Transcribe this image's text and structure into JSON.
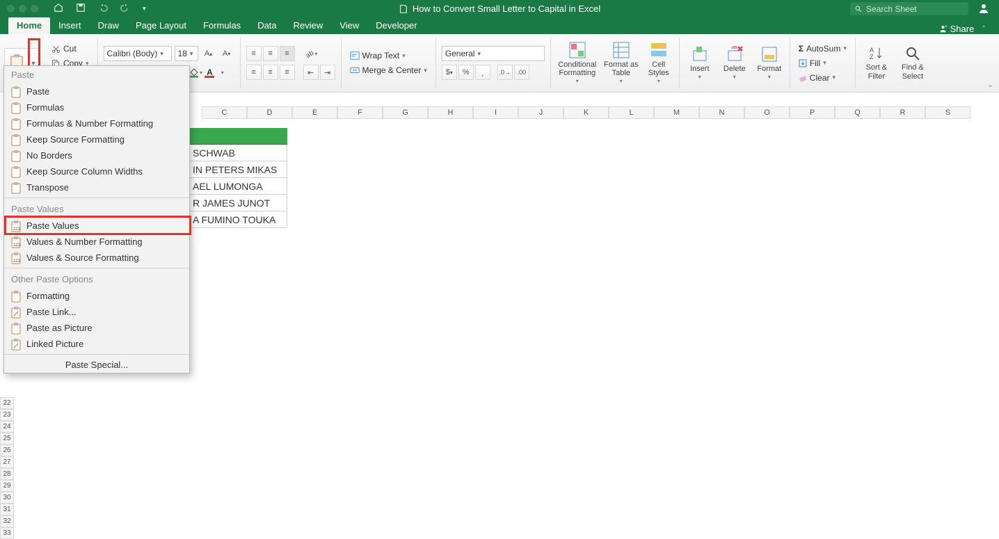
{
  "titlebar": {
    "title": "How to Convert Small Letter to Capital in Excel",
    "search_placeholder": "Search Sheet"
  },
  "tabs": {
    "items": [
      "Home",
      "Insert",
      "Draw",
      "Page Layout",
      "Formulas",
      "Data",
      "Review",
      "View",
      "Developer"
    ],
    "active": "Home",
    "share": "Share"
  },
  "clipboard": {
    "cut": "Cut",
    "copy": "Copy"
  },
  "font": {
    "name": "Calibri (Body)",
    "size": "18"
  },
  "alignment": {
    "wrap": "Wrap Text",
    "merge": "Merge & Center"
  },
  "number": {
    "format": "General"
  },
  "cells_group": {
    "cond": "Conditional Formatting",
    "fmtTable": "Format as Table",
    "cellStyles": "Cell Styles",
    "insert": "Insert",
    "delete": "Delete",
    "format": "Format"
  },
  "editing": {
    "autosum": "AutoSum",
    "fill": "Fill",
    "clear": "Clear",
    "sort": "Sort & Filter",
    "find": "Find & Select"
  },
  "menu": {
    "section_paste": "Paste",
    "items_paste": [
      "Paste",
      "Formulas",
      "Formulas & Number Formatting",
      "Keep Source Formatting",
      "No Borders",
      "Keep Source Column Widths",
      "Transpose"
    ],
    "section_values": "Paste Values",
    "items_values": [
      "Paste Values",
      "Values & Number Formatting",
      "Values & Source Formatting"
    ],
    "section_other": "Other Paste Options",
    "items_other": [
      "Formatting",
      "Paste Link...",
      "Paste as Picture",
      "Linked Picture"
    ],
    "special": "Paste Special..."
  },
  "sheet": {
    "columns": [
      "C",
      "D",
      "E",
      "F",
      "G",
      "H",
      "I",
      "J",
      "K",
      "L",
      "M",
      "N",
      "O",
      "P",
      "Q",
      "R",
      "S"
    ],
    "rows_visible": [
      22,
      23,
      24,
      25,
      26,
      27,
      28,
      29,
      30,
      31,
      32,
      33
    ],
    "cells_partial": [
      " SCHWAB",
      "IN PETERS MIKAS",
      "AEL LUMONGA",
      "R JAMES JUNOT",
      "A FUMINO TOUKA"
    ],
    "header_row_green": true
  },
  "currency_symbol": "$",
  "percent": "%"
}
